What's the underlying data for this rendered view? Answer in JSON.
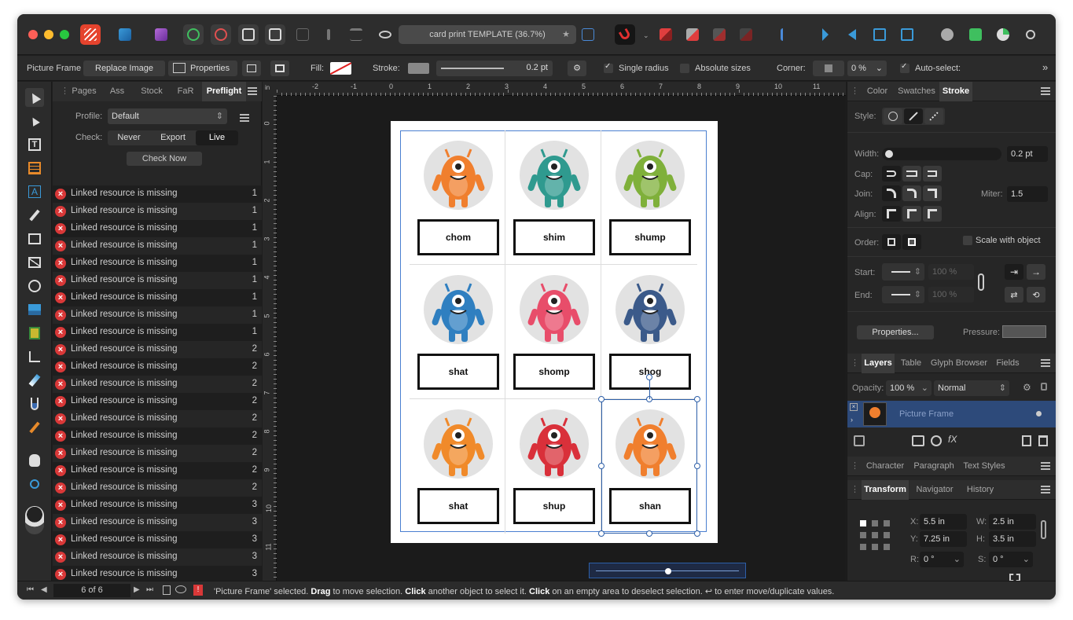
{
  "window": {
    "title": "card print TEMPLATE (36.7%)"
  },
  "context_bar": {
    "object_type": "Picture Frame",
    "replace_image": "Replace Image",
    "properties": "Properties",
    "fill_label": "Fill:",
    "stroke_label": "Stroke:",
    "stroke_width": "0.2 pt",
    "single_radius": "Single radius",
    "absolute_sizes": "Absolute sizes",
    "corner_label": "Corner:",
    "corner_value": "0 %",
    "auto_select": "Auto-select:"
  },
  "left_panel": {
    "tabs": [
      "Pages",
      "Ass",
      "Stock",
      "FaR",
      "Preflight"
    ],
    "profile_label": "Profile:",
    "profile_value": "Default",
    "check_label": "Check:",
    "check_options": [
      "Never",
      "Export",
      "Live"
    ],
    "check_now": "Check Now",
    "items": [
      {
        "message": "Linked resource is missing",
        "page": "1"
      },
      {
        "message": "Linked resource is missing",
        "page": "1"
      },
      {
        "message": "Linked resource is missing",
        "page": "1"
      },
      {
        "message": "Linked resource is missing",
        "page": "1"
      },
      {
        "message": "Linked resource is missing",
        "page": "1"
      },
      {
        "message": "Linked resource is missing",
        "page": "1"
      },
      {
        "message": "Linked resource is missing",
        "page": "1"
      },
      {
        "message": "Linked resource is missing",
        "page": "1"
      },
      {
        "message": "Linked resource is missing",
        "page": "1"
      },
      {
        "message": "Linked resource is missing",
        "page": "2"
      },
      {
        "message": "Linked resource is missing",
        "page": "2"
      },
      {
        "message": "Linked resource is missing",
        "page": "2"
      },
      {
        "message": "Linked resource is missing",
        "page": "2"
      },
      {
        "message": "Linked resource is missing",
        "page": "2"
      },
      {
        "message": "Linked resource is missing",
        "page": "2"
      },
      {
        "message": "Linked resource is missing",
        "page": "2"
      },
      {
        "message": "Linked resource is missing",
        "page": "2"
      },
      {
        "message": "Linked resource is missing",
        "page": "2"
      },
      {
        "message": "Linked resource is missing",
        "page": "3"
      },
      {
        "message": "Linked resource is missing",
        "page": "3"
      },
      {
        "message": "Linked resource is missing",
        "page": "3"
      },
      {
        "message": "Linked resource is missing",
        "page": "3"
      },
      {
        "message": "Linked resource is missing",
        "page": "3"
      },
      {
        "message": "Linked resource is missing",
        "page": "3"
      }
    ]
  },
  "rulers": {
    "horizontal": [
      "in",
      "-2",
      "-1",
      "0",
      "1",
      "2",
      "3",
      "4",
      "5",
      "6",
      "7",
      "8",
      "9",
      "10",
      "11"
    ],
    "vertical": [
      "0",
      "1",
      "2",
      "3",
      "4",
      "5",
      "6",
      "7",
      "8",
      "9",
      "10",
      "11"
    ]
  },
  "cards": [
    {
      "word": "chom",
      "body_color": "#f07f2e"
    },
    {
      "word": "shim",
      "body_color": "#2f9a8f"
    },
    {
      "word": "shump",
      "body_color": "#7fb03a"
    },
    {
      "word": "shat",
      "body_color": "#2f7fc0"
    },
    {
      "word": "shomp",
      "body_color": "#e84d6a"
    },
    {
      "word": "shog",
      "body_color": "#3b5a8a"
    },
    {
      "word": "shat",
      "body_color": "#f08a2a"
    },
    {
      "word": "shup",
      "body_color": "#d9303a"
    },
    {
      "word": "shan",
      "body_color": "#f07f2e"
    }
  ],
  "right_panel": {
    "tabs_top": [
      "Color",
      "Swatches",
      "Stroke"
    ],
    "style_label": "Style:",
    "width_label": "Width:",
    "width_value": "0.2 pt",
    "cap_label": "Cap:",
    "join_label": "Join:",
    "miter_label": "Miter:",
    "miter_value": "1.5",
    "align_label": "Align:",
    "order_label": "Order:",
    "scale_with_object": "Scale with object",
    "start_label": "Start:",
    "end_label": "End:",
    "start_pct": "100 %",
    "end_pct": "100 %",
    "properties_btn": "Properties...",
    "pressure_label": "Pressure:",
    "layer_tabs": [
      "Layers",
      "Table",
      "Glyph Browser",
      "Fields"
    ],
    "opacity_label": "Opacity:",
    "opacity_value": "100 %",
    "blend_mode": "Normal",
    "layer_name": "Picture Frame",
    "text_tabs": [
      "Character",
      "Paragraph",
      "Text Styles"
    ],
    "transform_tabs": [
      "Transform",
      "Navigator",
      "History"
    ],
    "x_label": "X:",
    "x_value": "5.5 in",
    "y_label": "Y:",
    "y_value": "7.25 in",
    "w_label": "W:",
    "w_value": "2.5 in",
    "h_label": "H:",
    "h_value": "3.5 in",
    "r_label": "R:",
    "r_value": "0 °",
    "s_label": "S:",
    "s_value": "0 °"
  },
  "status": {
    "page_indicator": "6 of 6",
    "p1": "'Picture Frame' selected. ",
    "b1": "Drag",
    "p2": " to move selection. ",
    "b2": "Click",
    "p3": " another object to select it. ",
    "b3": "Click",
    "p4": " on an empty area to deselect selection. ↩ to enter move/duplicate values."
  },
  "colors": {
    "accent": "#2d5fa8",
    "error": "#d93838",
    "selection": "#4a7fd0"
  }
}
